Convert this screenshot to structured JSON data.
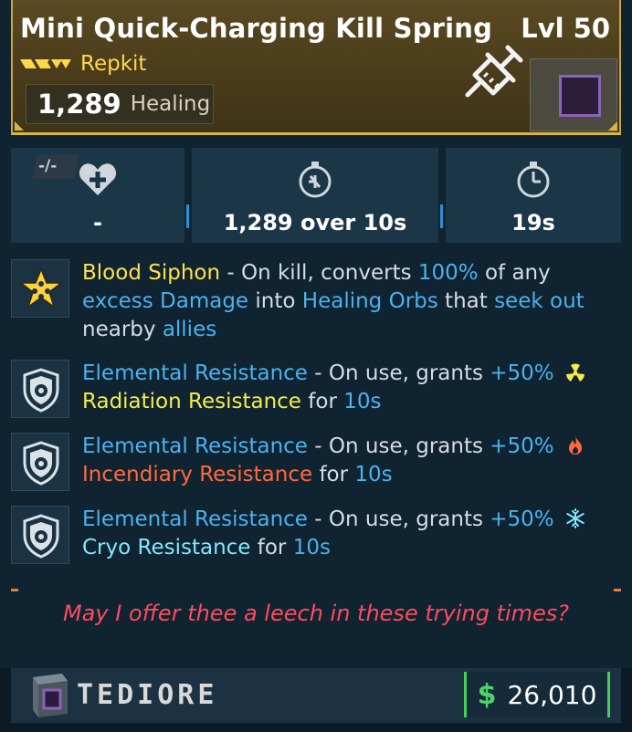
{
  "header": {
    "title": "Mini Quick-Charging Kill Spring",
    "level": "Lvl 50",
    "rarity": "Repkit",
    "healing_value": "1,289",
    "healing_label": "Healing",
    "rarity_color": "#ffd84a",
    "item_icon": "syringe-icon"
  },
  "stats": [
    {
      "icon": "heart-cross-icon",
      "badge": "-/-",
      "value": "-"
    },
    {
      "icon": "regen-stopwatch-icon",
      "value": "1,289 over 10s"
    },
    {
      "icon": "cooldown-stopwatch-icon",
      "value": "19s"
    }
  ],
  "perks": [
    {
      "icon": "blood-siphon-star-icon",
      "name": "Blood Siphon",
      "t1": " - On kill, converts ",
      "v1": "100%",
      "t2": " of any ",
      "v2": "excess Damage",
      "t3": " into ",
      "v3": "Healing Orbs",
      "t4": " that ",
      "v4": "seek out",
      "t5": " nearby ",
      "v5": "allies"
    },
    {
      "icon": "elemental-shield-icon",
      "name": "Elemental Resistance",
      "t1": " - On use, grants ",
      "v1": "+50%",
      "element_icon": "radiation-icon",
      "element": "Radiation Resistance",
      "t2": " for ",
      "v2": "10s"
    },
    {
      "icon": "elemental-shield-icon",
      "name": "Elemental Resistance",
      "t1": " - On use, grants ",
      "v1": "+50%",
      "element_icon": "fire-icon",
      "element": "Incendiary Resistance",
      "t2": " for ",
      "v2": "10s"
    },
    {
      "icon": "elemental-shield-icon",
      "name": "Elemental Resistance",
      "t1": " - On use, grants ",
      "v1": "+50%",
      "element_icon": "snowflake-icon",
      "element": "Cryo Resistance",
      "t2": " for ",
      "v2": "10s"
    }
  ],
  "flavor": "May I offer thee a leech in these trying times?",
  "footer": {
    "manufacturer": "TEDIORE",
    "price_symbol": "$",
    "price": "26,010"
  },
  "colors": {
    "header_border": "#d8b643",
    "highlight": "#4ab2ee",
    "flavor": "#ff4b5c",
    "price_accent": "#42d05a"
  }
}
